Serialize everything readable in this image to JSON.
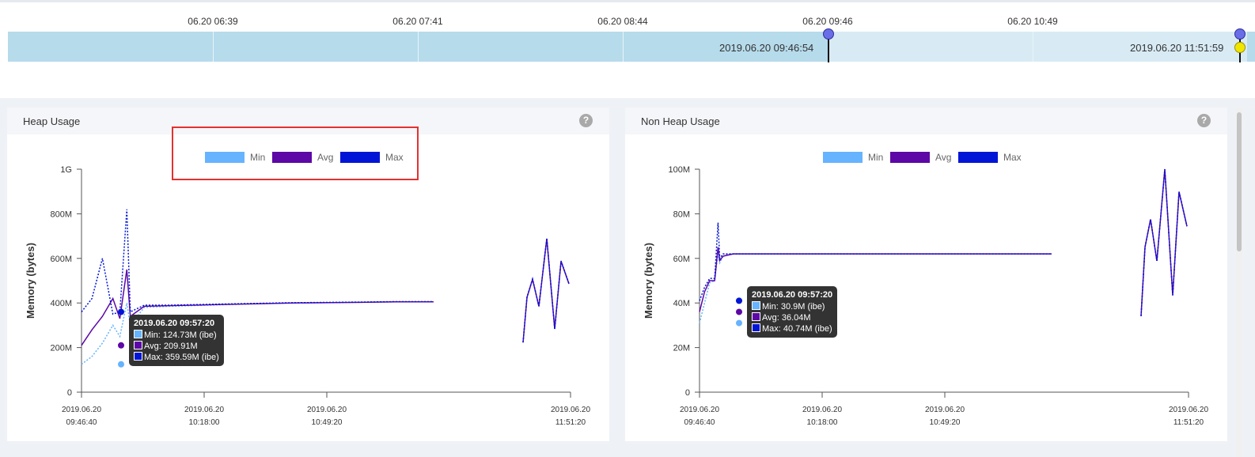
{
  "timeline": {
    "ticks": [
      "06.20 06:39",
      "06.20 07:41",
      "06.20 08:44",
      "06.20 09:46",
      "06.20 10:49"
    ],
    "range_start": "2019.06.20 09:46:54",
    "range_end": "2019.06.20 11:51:59"
  },
  "legend": {
    "min": "Min",
    "avg": "Avg",
    "max": "Max"
  },
  "colors": {
    "min": "#66b3ff",
    "avg": "#5c07a6",
    "max": "#0015d6",
    "highlight": "#e53030"
  },
  "heap": {
    "title": "Heap Usage",
    "ylabel": "Memory (bytes)",
    "yticks": [
      "0",
      "200M",
      "400M",
      "600M",
      "800M",
      "1G"
    ],
    "xticks": [
      {
        "date": "2019.06.20",
        "time": "09:46:40"
      },
      {
        "date": "2019.06.20",
        "time": "10:18:00"
      },
      {
        "date": "2019.06.20",
        "time": "10:49:20"
      },
      {
        "date": "2019.06.20",
        "time": "11:51:20"
      }
    ],
    "tooltip": {
      "title": "2019.06.20 09:57:20",
      "min": "Min: 124.73M (ibe)",
      "avg": "Avg: 209.91M",
      "max": "Max: 359.59M (ibe)"
    }
  },
  "nonheap": {
    "title": "Non Heap Usage",
    "ylabel": "Memory (bytes)",
    "yticks": [
      "0",
      "20M",
      "40M",
      "60M",
      "80M",
      "100M"
    ],
    "xticks": [
      {
        "date": "2019.06.20",
        "time": "09:46:40"
      },
      {
        "date": "2019.06.20",
        "time": "10:18:00"
      },
      {
        "date": "2019.06.20",
        "time": "10:49:20"
      },
      {
        "date": "2019.06.20",
        "time": "11:51:20"
      }
    ],
    "tooltip": {
      "title": "2019.06.20 09:57:20",
      "min": "Min: 30.9M (ibe)",
      "avg": "Avg: 36.04M",
      "max": "Max: 40.74M (ibe)"
    }
  },
  "chart_data": [
    {
      "type": "line",
      "ylim": [
        0,
        1000
      ],
      "series": [
        {
          "name": "Min",
          "x": [
            0,
            3,
            6,
            9,
            11,
            13,
            14,
            18,
            25,
            40,
            60,
            80,
            90,
            101
          ],
          "values": [
            125,
            160,
            220,
            300,
            250,
            400,
            300,
            380,
            385,
            392,
            400,
            403,
            405,
            405
          ]
        },
        {
          "name": "Avg",
          "x": [
            0,
            3,
            6,
            9,
            11,
            13,
            14,
            18,
            25,
            40,
            60,
            80,
            90,
            101
          ],
          "values": [
            210,
            280,
            340,
            420,
            330,
            550,
            340,
            385,
            388,
            393,
            400,
            403,
            405,
            405
          ]
        },
        {
          "name": "Max",
          "x": [
            0,
            3,
            6,
            9,
            11,
            13,
            14,
            18,
            25,
            40,
            60,
            80,
            90,
            101
          ],
          "values": [
            360,
            420,
            600,
            350,
            360,
            820,
            360,
            390,
            390,
            395,
            401,
            404,
            406,
            406
          ]
        }
      ]
    },
    {
      "type": "line",
      "ylim": [
        0,
        100
      ],
      "series": [
        {
          "name": "Min",
          "x": [
            0,
            3,
            6,
            9,
            11,
            12,
            14,
            20,
            40,
            80,
            110,
            140,
            180,
            209
          ],
          "values": [
            31,
            40,
            49,
            50,
            62,
            58,
            61,
            62,
            62,
            62,
            62,
            62,
            62,
            62
          ]
        },
        {
          "name": "Avg",
          "x": [
            0,
            3,
            6,
            9,
            11,
            12,
            14,
            20,
            40,
            80,
            110,
            140,
            180,
            209
          ],
          "values": [
            36,
            45,
            50,
            50,
            65,
            59,
            61,
            62,
            62,
            62,
            62,
            62,
            62,
            62
          ]
        },
        {
          "name": "Max",
          "x": [
            0,
            3,
            6,
            9,
            11,
            12,
            14,
            20,
            40,
            80,
            110,
            140,
            180,
            209
          ],
          "values": [
            41,
            47,
            51,
            51,
            76,
            60,
            62,
            62,
            62,
            62,
            62,
            62,
            62,
            62
          ]
        }
      ]
    }
  ]
}
